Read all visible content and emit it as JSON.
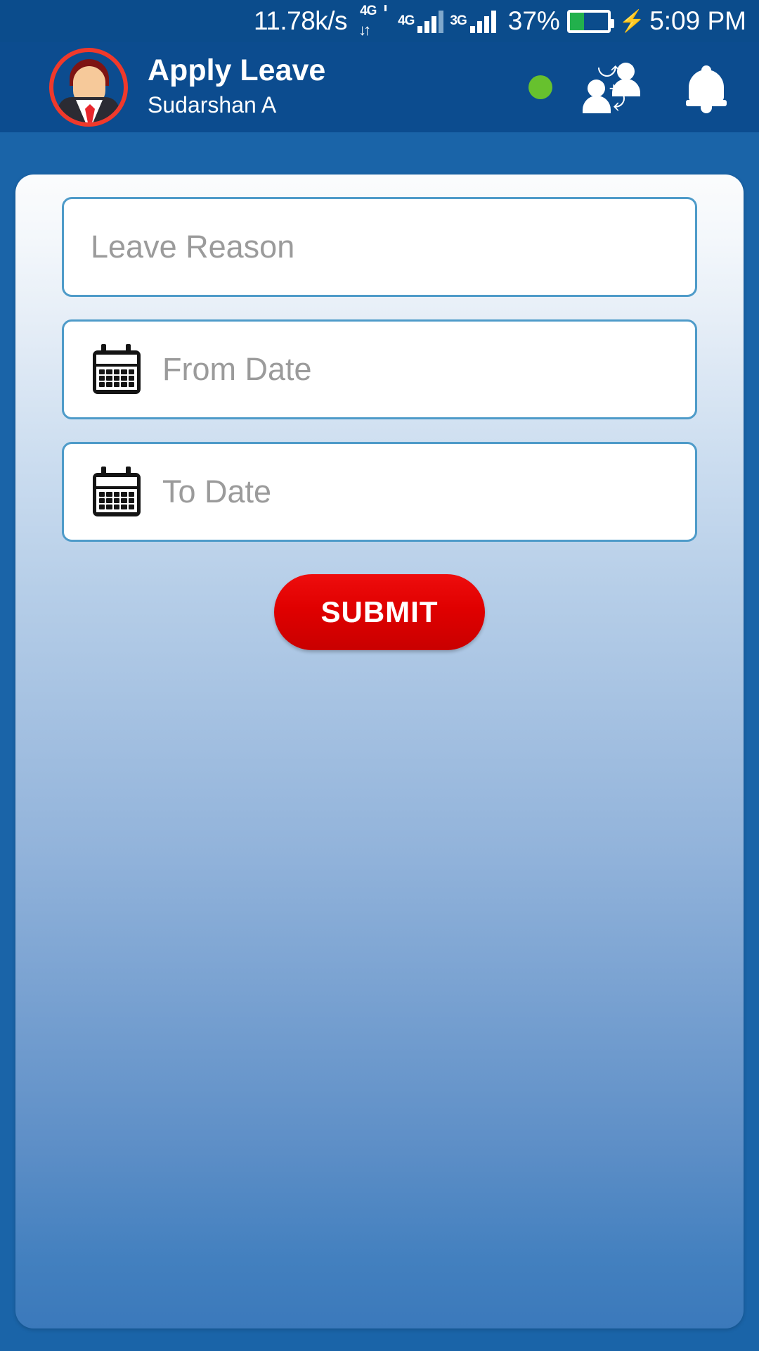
{
  "status_bar": {
    "network_speed": "11.78k/s",
    "data_icon_label": "4G",
    "network_type": "4G",
    "secondary_network_type": "3G",
    "battery_percent": "37%",
    "battery_level": 37,
    "charging": true,
    "time": "5:09 PM"
  },
  "header": {
    "title": "Apply Leave",
    "user_name": "Sudarshan A",
    "status_dot_color": "#67C12E",
    "icons": {
      "avatar": "user-avatar",
      "online_status": "online-status-dot",
      "switch_user": "switch-user-icon",
      "notifications": "bell-icon"
    }
  },
  "form": {
    "fields": [
      {
        "name": "leave-reason",
        "placeholder": "Leave Reason",
        "value": "",
        "icon": null
      },
      {
        "name": "from-date",
        "placeholder": "From Date",
        "value": "",
        "icon": "calendar-icon"
      },
      {
        "name": "to-date",
        "placeholder": "To Date",
        "value": "",
        "icon": "calendar-icon"
      }
    ],
    "submit_label": "SUBMIT"
  },
  "colors": {
    "status_bar_bg": "#0B4C8C",
    "app_bar_bg": "#0C4C8F",
    "field_border": "#4E9BC9",
    "placeholder": "#9B9B9B",
    "submit_red": "#E00000",
    "avatar_ring": "#F0392B"
  }
}
